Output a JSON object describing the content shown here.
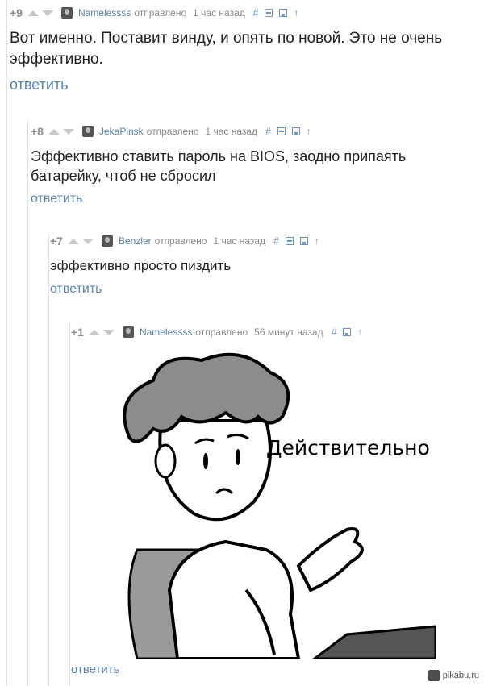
{
  "comments": [
    {
      "rating": "+9",
      "author": "Namelessss",
      "sent": "отправлено",
      "time": "1 час назад",
      "hash": "#",
      "up": "↑",
      "text": "Вот именно. Поставит винду, и опять по новой. Это не очень эффективно.",
      "reply": "ответить"
    },
    {
      "rating": "+8",
      "author": "JekaPinsk",
      "sent": "отправлено",
      "time": "1 час назад",
      "hash": "#",
      "up": "↑",
      "text": "Эффективно ставить пароль на BIOS, заодно припаять батарейку, чтоб не сбросил",
      "reply": "ответить"
    },
    {
      "rating": "+7",
      "author": "Benzler",
      "sent": "отправлено",
      "time": "1 час назад",
      "hash": "#",
      "up": "↑",
      "text": "эффективно просто пиздить",
      "reply": "ответить"
    },
    {
      "rating": "+1",
      "author": "Namelessss",
      "sent": "отправлено",
      "time": "56 минут назад",
      "hash": "#",
      "up": "↑",
      "image_caption": "Действительно",
      "reply": "ответить"
    }
  ],
  "watermark": "pikabu.ru"
}
